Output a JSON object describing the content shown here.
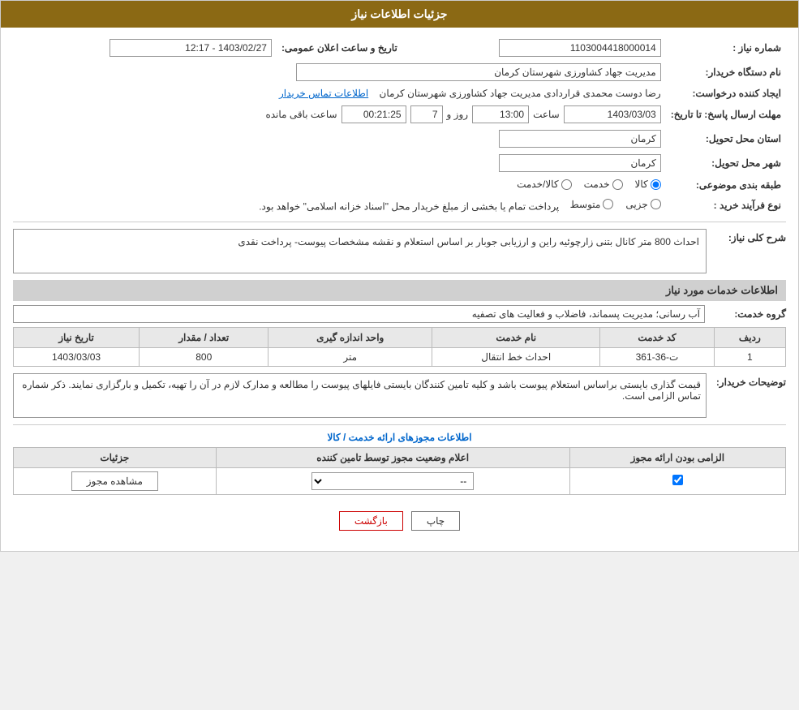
{
  "header": {
    "title": "جزئیات اطلاعات نیاز"
  },
  "fields": {
    "need_number_label": "شماره نیاز :",
    "need_number_value": "1103004418000014",
    "announcement_date_label": "تاریخ و ساعت اعلان عمومی:",
    "announcement_date_value": "1403/02/27 - 12:17",
    "buyer_org_label": "نام دستگاه خریدار:",
    "buyer_org_value": "مدیریت جهاد کشاورزی شهرستان کرمان",
    "requester_label": "ایجاد کننده درخواست:",
    "requester_value": "رضا دوست محمدی قراردادی مدیریت جهاد کشاورزی شهرستان کرمان",
    "requester_link": "اطلاعات تماس خریدار",
    "deadline_label": "مهلت ارسال پاسخ: تا تاریخ:",
    "deadline_date": "1403/03/03",
    "deadline_time_label": "ساعت",
    "deadline_time": "13:00",
    "deadline_days_label": "روز و",
    "deadline_days": "7",
    "deadline_remain_label": "ساعت باقی مانده",
    "deadline_remain": "00:21:25",
    "province_label": "استان محل تحویل:",
    "province_value": "کرمان",
    "city_label": "شهر محل تحویل:",
    "city_value": "کرمان",
    "category_label": "طبقه بندی موضوعی:",
    "category_options": [
      "کالا",
      "خدمت",
      "کالا/خدمت"
    ],
    "category_selected": "کالا",
    "purchase_type_label": "نوع فرآیند خرید :",
    "purchase_type_options": [
      "جزیی",
      "متوسط"
    ],
    "purchase_type_note": "پرداخت تمام یا بخشی از مبلغ خریدار محل \"اسناد خزانه اسلامی\" خواهد بود.",
    "needs_section_label": "شرح کلی نیاز:",
    "needs_description": "احداث 800 متر کانال بتنی زارچوئیه راین و ارزیابی جوبار بر اساس استعلام و نقشه مشخصات پیوست- پرداخت نقدی",
    "services_section_title": "اطلاعات خدمات مورد نیاز",
    "service_group_label": "گروه خدمت:",
    "service_group_value": "آب رسانی؛ مدیریت پسماند، فاضلاب و فعالیت های تصفیه",
    "table_headers": {
      "row_num": "ردیف",
      "service_code": "کد خدمت",
      "service_name": "نام خدمت",
      "unit": "واحد اندازه گیری",
      "quantity": "تعداد / مقدار",
      "date": "تاریخ نیاز"
    },
    "table_rows": [
      {
        "row_num": "1",
        "service_code": "ت-36-361",
        "service_name": "احداث خط انتقال",
        "unit": "متر",
        "quantity": "800",
        "date": "1403/03/03"
      }
    ],
    "buyer_notes_label": "توضیحات خریدار:",
    "buyer_notes_text": "قیمت گذاری بایستی براساس استعلام پیوست باشد و کلیه تامین کنندگان بایستی فایلهای پیوست را مطالعه و مدارک لازم در آن را تهیه، تکمیل و بارگزاری نمایند. ذکر شماره تماس الزامی است.",
    "permissions_section_title": "اطلاعات مجوزهای ارائه خدمت / کالا",
    "permissions_table_headers": {
      "mandatory": "الزامی بودن ارائه مجوز",
      "supplier_status": "اعلام وضعیت مجوز توسط تامین کننده",
      "details": "جزئیات"
    },
    "permissions_rows": [
      {
        "mandatory": true,
        "supplier_status": "--",
        "details_btn": "مشاهده مجوز"
      }
    ],
    "btn_print": "چاپ",
    "btn_back": "بازگشت"
  }
}
